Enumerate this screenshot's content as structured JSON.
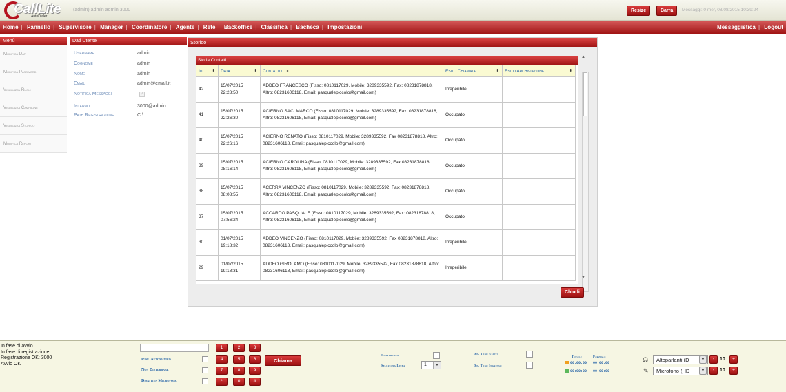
{
  "header": {
    "logo_text": "CallLite",
    "logo_sub": "AutoDialer",
    "user_info": "(admin) admin admin   3000",
    "resize_label": "Resize",
    "barra_label": "Barra",
    "messages_info": "Messaggi: 0    mer, 08/08/2015 10:39:24"
  },
  "nav": {
    "items": [
      "Home",
      "Pannello",
      "Supervisore",
      "Manager",
      "Coordinatore",
      "Agente",
      "Rete",
      "Backoffice",
      "Classifica",
      "Bacheca",
      "Impostazioni"
    ],
    "messaggistica": "Messaggistica",
    "logout": "Logout"
  },
  "menu": {
    "title": "Menù",
    "items": [
      "Modifica Dati",
      "Modifica Password",
      "Visualizza Ruoli",
      "Visualizza Campagne",
      "Visualizza Storico",
      "Modifica Report"
    ]
  },
  "user_panel": {
    "title": "Dati Utente",
    "username_label": "Username",
    "username": "admin",
    "cognome_label": "Cognome",
    "cognome": "admin",
    "nome_label": "Nome",
    "nome": "admin",
    "email_label": "Email",
    "email": "admin@email.it",
    "notifica_label": "Notifica Messaggi",
    "notifica_checked": true,
    "interno_label": "Interno",
    "interno": "3000@admin",
    "path_label": "Path Registrazione",
    "path": "C:\\"
  },
  "storico": {
    "title": "Storico",
    "subtitle": "Storia Contatti",
    "columns": [
      "Id",
      "Data",
      "Contatto",
      "Esito Chiamata",
      "Esito Archiviazione"
    ],
    "rows": [
      {
        "id": "42",
        "date": "15/07/2015",
        "time": "22:28:50",
        "contact": "ADDEO FRANCESCO (Fisso: 0810117029, Mobile: 3289335592, Fax: 08231878818, Altro: 08231606118, Email: pasqualepiccolo@gmail.com)",
        "esito": "Irreperibile",
        "archiviazione": ""
      },
      {
        "id": "41",
        "date": "15/07/2015",
        "time": "22:26:30",
        "contact": "ACIERNO SAC. MARCO (Fisso: 0810117029, Mobile: 3289335592, Fax: 08231878818, Altro: 08231606118, Email: pasqualepiccolo@gmail.com)",
        "esito": "Occupato",
        "archiviazione": ""
      },
      {
        "id": "40",
        "date": "15/07/2015",
        "time": "22:26:16",
        "contact": "ACIERNO RENATO (Fisso: 0810117029, Mobile: 3289335592, Fax 08231878818, Altro: 08231606118, Email: pasqualepiccolo@gmail.com)",
        "esito": "Occupato",
        "archiviazione": ""
      },
      {
        "id": "39",
        "date": "15/07/2015",
        "time": "08:16:14",
        "contact": "ACIERNO CAROLINA (Fisso: 0810117029, Mobile: 3289335592, Fax 08231878818, Altro: 08231606118, Email: pasqualepiccolo@gmail.com)",
        "esito": "Occupato",
        "archiviazione": ""
      },
      {
        "id": "38",
        "date": "15/07/2015",
        "time": "08:08:55",
        "contact": "ACERRA VINCENZO (Fisso: 0810117029, Mobile: 3289335592, Fax: 08231878818, Altro: 08231606118, Email: pasqualepiccolo@gmail.com)",
        "esito": "Occupato",
        "archiviazione": ""
      },
      {
        "id": "37",
        "date": "15/07/2015",
        "time": "07:56:24",
        "contact": "ACCARDO PASQUALE (Fisso: 0810117029, Mobile: 3289335592, Fax: 08231878818, Altro: 08231606118, Email: pasqualepiccolo@gmail.com)",
        "esito": "Occupato",
        "archiviazione": ""
      },
      {
        "id": "30",
        "date": "01/07/2015",
        "time": "19:18:32",
        "contact": "ADDEO VINCENZO (Fisso: 0810117029, Mobile: 3289335592, Fax 08231878818, Altro: 08231606118, Email: pasqualepiccolo@gmail.com)",
        "esito": "Irreperibile",
        "archiviazione": ""
      },
      {
        "id": "29",
        "date": "01/07/2015",
        "time": "19:18:31",
        "contact": "ADDEO GIROLAMO (Fisso: 0810117029, Mobile: 3289335592, Fax 08231878818, Altro: 08231606118, Email: pasqualepiccolo@gmail.com)",
        "esito": "Irreperibile",
        "archiviazione": ""
      }
    ],
    "close_label": "Chiudi"
  },
  "phone": {
    "log": [
      "In fase di avvio ...",
      "In fase di registrazione ...",
      "Registrazione OK: 3000",
      "Avvio OK"
    ],
    "dial_value": "",
    "options": [
      "Risp. Automatico",
      "Non Disturbare",
      "Disattiva Microfono"
    ],
    "keys": [
      "1",
      "2",
      "3",
      "4",
      "5",
      "6",
      "7",
      "8",
      "9",
      "*",
      "0",
      "#"
    ],
    "call_label": "Chiama",
    "conferenza_label": "Conferenza",
    "seleziona_linea_label": "Seleziona Linea",
    "linea_value": "1",
    "dis_tono_uscita_label": "Dis. Tono Uscita",
    "dis_tono_ingresso_label": "Dis. Tono Ingresso",
    "totale_label": "Totale",
    "parziale_label": "Parziale",
    "line1_totale": "00:00:00",
    "line1_parziale": "00:00:00",
    "line2_totale": "00:00:00",
    "line2_parziale": "00:00:00",
    "line1_color": "#f0a020",
    "line2_color": "#5cb85c",
    "speaker_value": "Altoparlanti (D",
    "speaker_volume": "10",
    "mic_value": "Microfono (HD",
    "mic_volume": "10",
    "minus": "-",
    "plus": "+"
  },
  "colors": {
    "accent": "#b5131f",
    "link": "#1e5ea5"
  }
}
